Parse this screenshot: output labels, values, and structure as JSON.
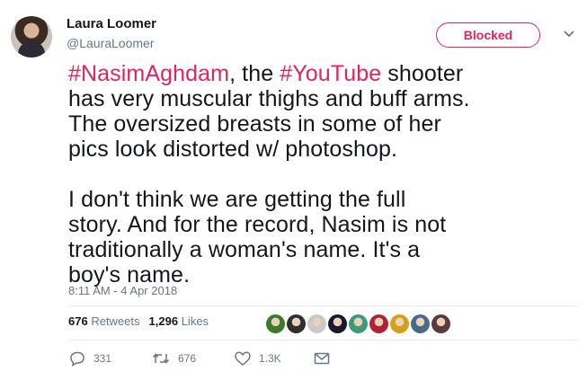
{
  "author": {
    "name": "Laura Loomer",
    "handle": "@LauraLoomer"
  },
  "follow_button": {
    "label": "Blocked"
  },
  "tweet": {
    "lines": [
      [
        {
          "text": "#NasimAghdam",
          "hashtag": true
        },
        {
          "text": ", the ",
          "hashtag": false
        },
        {
          "text": "#YouTube",
          "hashtag": true
        },
        {
          "text": " shooter",
          "hashtag": false
        }
      ],
      "has very muscular thighs and buff arms.",
      "The oversized breasts in some of her",
      "pics look distorted w/ photoshop.",
      "",
      "I don't think we are  getting the full",
      "story. And for the record, Nasim is not",
      "traditionally a woman's name. It's a",
      "boy's name."
    ]
  },
  "timestamp": "8:11 AM - 4 Apr 2018",
  "stats": {
    "retweets_count": "676",
    "retweets_label": "Retweets",
    "likes_count": "1,296",
    "likes_label": "Likes"
  },
  "likers": [
    {
      "icon": "liker-avatar-1",
      "color": "#3d7a2a"
    },
    {
      "icon": "liker-avatar-2",
      "color": "#2f2f2f"
    },
    {
      "icon": "liker-avatar-3",
      "color": "#c9c9c9"
    },
    {
      "icon": "liker-avatar-4",
      "color": "#1a1a2e"
    },
    {
      "icon": "liker-avatar-5",
      "color": "#3f9a7c"
    },
    {
      "icon": "liker-avatar-6",
      "color": "#b22234"
    },
    {
      "icon": "liker-avatar-7",
      "color": "#d4a017"
    },
    {
      "icon": "liker-avatar-8",
      "color": "#4a6a8a"
    },
    {
      "icon": "liker-avatar-9",
      "color": "#5a3a3a"
    }
  ],
  "actions": {
    "reply": {
      "icon": "reply-icon",
      "count": "331"
    },
    "retweet": {
      "icon": "retweet-icon",
      "count": "676"
    },
    "like": {
      "icon": "heart-icon",
      "count": "1.3K"
    },
    "message": {
      "icon": "envelope-icon"
    }
  },
  "colors": {
    "hashtag": "#e0245e",
    "blocked": "#e0245e",
    "muted_text": "#657786"
  }
}
